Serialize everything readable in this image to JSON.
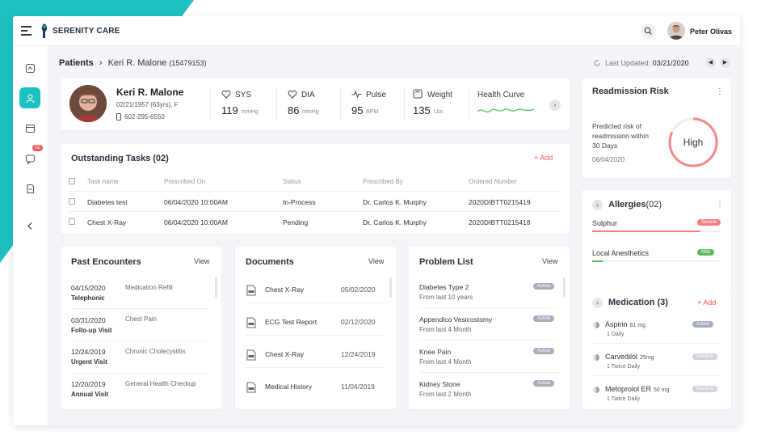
{
  "app": {
    "brand": "SERENITY CARE",
    "user_name": "Peter Olivas"
  },
  "nav": {
    "message_badge": "02"
  },
  "breadcrumb": {
    "root": "Patients",
    "patient": "Keri R. Malone",
    "patient_id": "(15479153)"
  },
  "last_updated": {
    "label": "Last Updated:",
    "date": "03/21/2020"
  },
  "patient": {
    "name": "Keri R. Malone",
    "dob": "02/21/1957 (63yrs), F",
    "phone": "602-295-6550",
    "vitals": [
      {
        "label": "SYS",
        "value": "119",
        "unit": "mmHg",
        "icon": "heart-icon"
      },
      {
        "label": "DIA",
        "value": "86",
        "unit": "mmHg",
        "icon": "heart-icon"
      },
      {
        "label": "Pulse",
        "value": "95",
        "unit": "BPM",
        "icon": "pulse-icon"
      },
      {
        "label": "Weight",
        "value": "135",
        "unit": "Lbs",
        "icon": "scale-icon"
      }
    ],
    "health_curve_label": "Health Curve"
  },
  "readmission": {
    "title": "Readmission Risk",
    "desc": "Predicted risk of readmission within 30 Days",
    "date": "06/04/2020",
    "level": "High",
    "fraction": 0.82
  },
  "tasks": {
    "title": "Outstanding Tasks (02)",
    "add_label": "+ Add",
    "columns": [
      "Task name",
      "Prescribed On",
      "Status",
      "Prescribed By",
      "Ordered Number"
    ],
    "rows": [
      [
        "Diabetes test",
        "06/04/2020 10:00AM",
        "In-Process",
        "Dr. Carlos K. Murphy",
        "2020DIBTT0215419"
      ],
      [
        "Chest X-Ray",
        "06/04/2020 10:00AM",
        "Pending",
        "Dr. Carlos K. Murphy",
        "2020DIBTT0215418"
      ]
    ]
  },
  "allergies": {
    "title": "Allergies",
    "count": "(02)",
    "items": [
      {
        "name": "Sulphur",
        "badge": "Severe",
        "color": "#f08080",
        "level": 0.85
      },
      {
        "name": "Local Anesthetics",
        "badge": "Mild",
        "color": "#5cb85c",
        "level": 0.08
      }
    ]
  },
  "encounters": {
    "title": "Past Encounters",
    "view": "View",
    "items": [
      {
        "date": "04/15/2020",
        "type": "Telephonic",
        "reason": "Medication Refill"
      },
      {
        "date": "03/31/2020",
        "type": "Follo-up Visit",
        "reason": "Chest Pain"
      },
      {
        "date": "12/24/2019",
        "type": "Urgent Visit",
        "reason": "Chronic Cholecystitis"
      },
      {
        "date": "12/20/2019",
        "type": "Annual Visit",
        "reason": "General Health Checkup"
      }
    ]
  },
  "documents": {
    "title": "Documents",
    "view": "View",
    "items": [
      {
        "name": "Chest X-Ray",
        "date": "05/02/2020"
      },
      {
        "name": "ECG Test Report",
        "date": "02/12/2020"
      },
      {
        "name": "Chest X-Ray",
        "date": "12/24/2019"
      },
      {
        "name": "Medical History",
        "date": "11/04/2019"
      }
    ]
  },
  "problems": {
    "title": "Problem List",
    "view": "View",
    "items": [
      {
        "name": "Diabetes Type 2",
        "since": "From last 10 years",
        "status": "Active"
      },
      {
        "name": "Appendico Vesicostomy",
        "since": "From last 4 Month",
        "status": "Active"
      },
      {
        "name": "Knee Pain",
        "since": "From last 4 Month",
        "status": "Active"
      },
      {
        "name": "Kidney Stone",
        "since": "From last 2 Month",
        "status": "Active"
      }
    ]
  },
  "medication": {
    "title": "Medication (3)",
    "add_label": "+ Add",
    "items": [
      {
        "name": "Aspirin",
        "dose": "81 mg",
        "freq": "1 Daily",
        "status": "Active"
      },
      {
        "name": "Carvedilol",
        "dose": "25mg",
        "freq": "1 Twice Daily",
        "status": "Inactive"
      },
      {
        "name": "Metoprolol ER",
        "dose": "50 mg",
        "freq": "1 Twice Daily",
        "status": "Inactive"
      }
    ]
  },
  "colors": {
    "accent": "#1ec1c1",
    "danger": "#f15a5a",
    "active_pill": "#a7adbd",
    "inactive_pill": "#cfd3db"
  }
}
